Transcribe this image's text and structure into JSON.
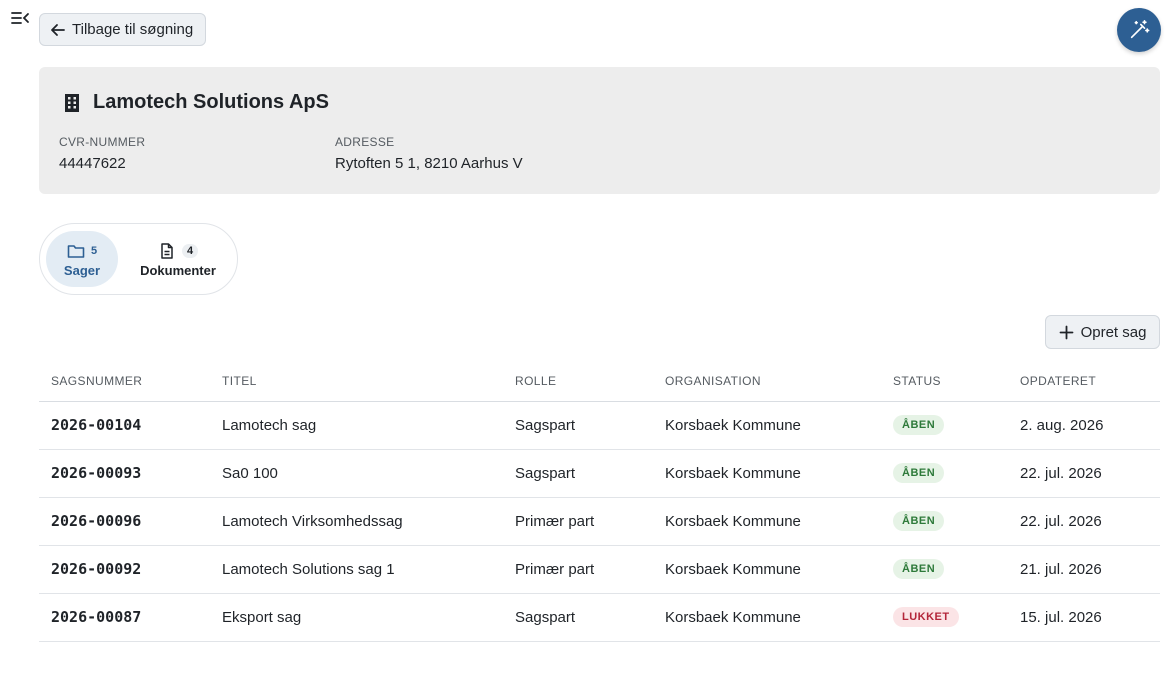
{
  "nav": {
    "back_label": "Tilbage til søgning"
  },
  "company": {
    "name": "Lamotech Solutions ApS",
    "cvr_label": "CVR-NUMMER",
    "cvr_value": "44447622",
    "address_label": "ADRESSE",
    "address_value": "Rytoften 5 1, 8210 Aarhus V"
  },
  "tabs": [
    {
      "label": "Sager",
      "count": "5",
      "icon": "folder-icon"
    },
    {
      "label": "Dokumenter",
      "count": "4",
      "icon": "document-icon"
    }
  ],
  "actions": {
    "create_label": "Opret sag"
  },
  "table": {
    "headers": [
      "SAGSNUMMER",
      "TITEL",
      "ROLLE",
      "ORGANISATION",
      "STATUS",
      "OPDATERET"
    ],
    "rows": [
      {
        "number": "2026-00104",
        "title": "Lamotech sag",
        "role": "Sagspart",
        "org": "Korsbaek Kommune",
        "status": "ÅBEN",
        "updated": "2. aug. 2026"
      },
      {
        "number": "2026-00093",
        "title": "Sa0 100",
        "role": "Sagspart",
        "org": "Korsbaek Kommune",
        "status": "ÅBEN",
        "updated": "22. jul. 2026"
      },
      {
        "number": "2026-00096",
        "title": "Lamotech Virksomhedssag",
        "role": "Primær part",
        "org": "Korsbaek Kommune",
        "status": "ÅBEN",
        "updated": "22. jul. 2026"
      },
      {
        "number": "2026-00092",
        "title": "Lamotech Solutions sag 1",
        "role": "Primær part",
        "org": "Korsbaek Kommune",
        "status": "ÅBEN",
        "updated": "21. jul. 2026"
      },
      {
        "number": "2026-00087",
        "title": "Eksport sag",
        "role": "Sagspart",
        "org": "Korsbaek Kommune",
        "status": "LUKKET",
        "updated": "15. jul. 2026"
      }
    ]
  },
  "colors": {
    "accent": "#2d5f93",
    "open_badge_bg": "#e6f3e6",
    "open_badge_text": "#2e7a3a",
    "closed_badge_bg": "#fbe4e6",
    "closed_badge_text": "#b3263a"
  },
  "icons": {
    "sidebar_toggle": "sidebar-collapse-icon",
    "back": "arrow-left-icon",
    "magic": "magic-wand-icon",
    "company": "building-icon",
    "create": "plus-icon"
  }
}
